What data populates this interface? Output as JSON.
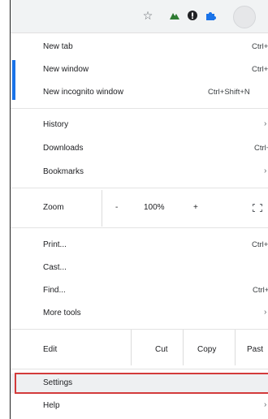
{
  "toolbar": {
    "icons": [
      "star-icon",
      "extension-icon",
      "extension-icon",
      "puzzle-extension-icon",
      "profile-avatar"
    ]
  },
  "menu": {
    "new_tab": {
      "label": "New tab",
      "shortcut": "Ctrl+T"
    },
    "new_window": {
      "label": "New window",
      "shortcut": "Ctrl+N"
    },
    "new_incognito": {
      "label": "New incognito window",
      "shortcut": "Ctrl+Shift+N"
    },
    "history": {
      "label": "History"
    },
    "downloads": {
      "label": "Downloads",
      "shortcut": "Ctrl+J"
    },
    "bookmarks": {
      "label": "Bookmarks"
    },
    "zoom": {
      "label": "Zoom",
      "minus": "-",
      "value": "100%",
      "plus": "+"
    },
    "print": {
      "label": "Print...",
      "shortcut": "Ctrl+P"
    },
    "cast": {
      "label": "Cast..."
    },
    "find": {
      "label": "Find...",
      "shortcut": "Ctrl+F"
    },
    "more_tools": {
      "label": "More tools"
    },
    "edit": {
      "label": "Edit",
      "cut": "Cut",
      "copy": "Copy",
      "paste": "Past"
    },
    "settings": {
      "label": "Settings"
    },
    "help": {
      "label": "Help"
    }
  },
  "arrow_glyph": "›",
  "colors": {
    "accent": "#1a73e8",
    "highlight_border": "#d33b3b"
  }
}
